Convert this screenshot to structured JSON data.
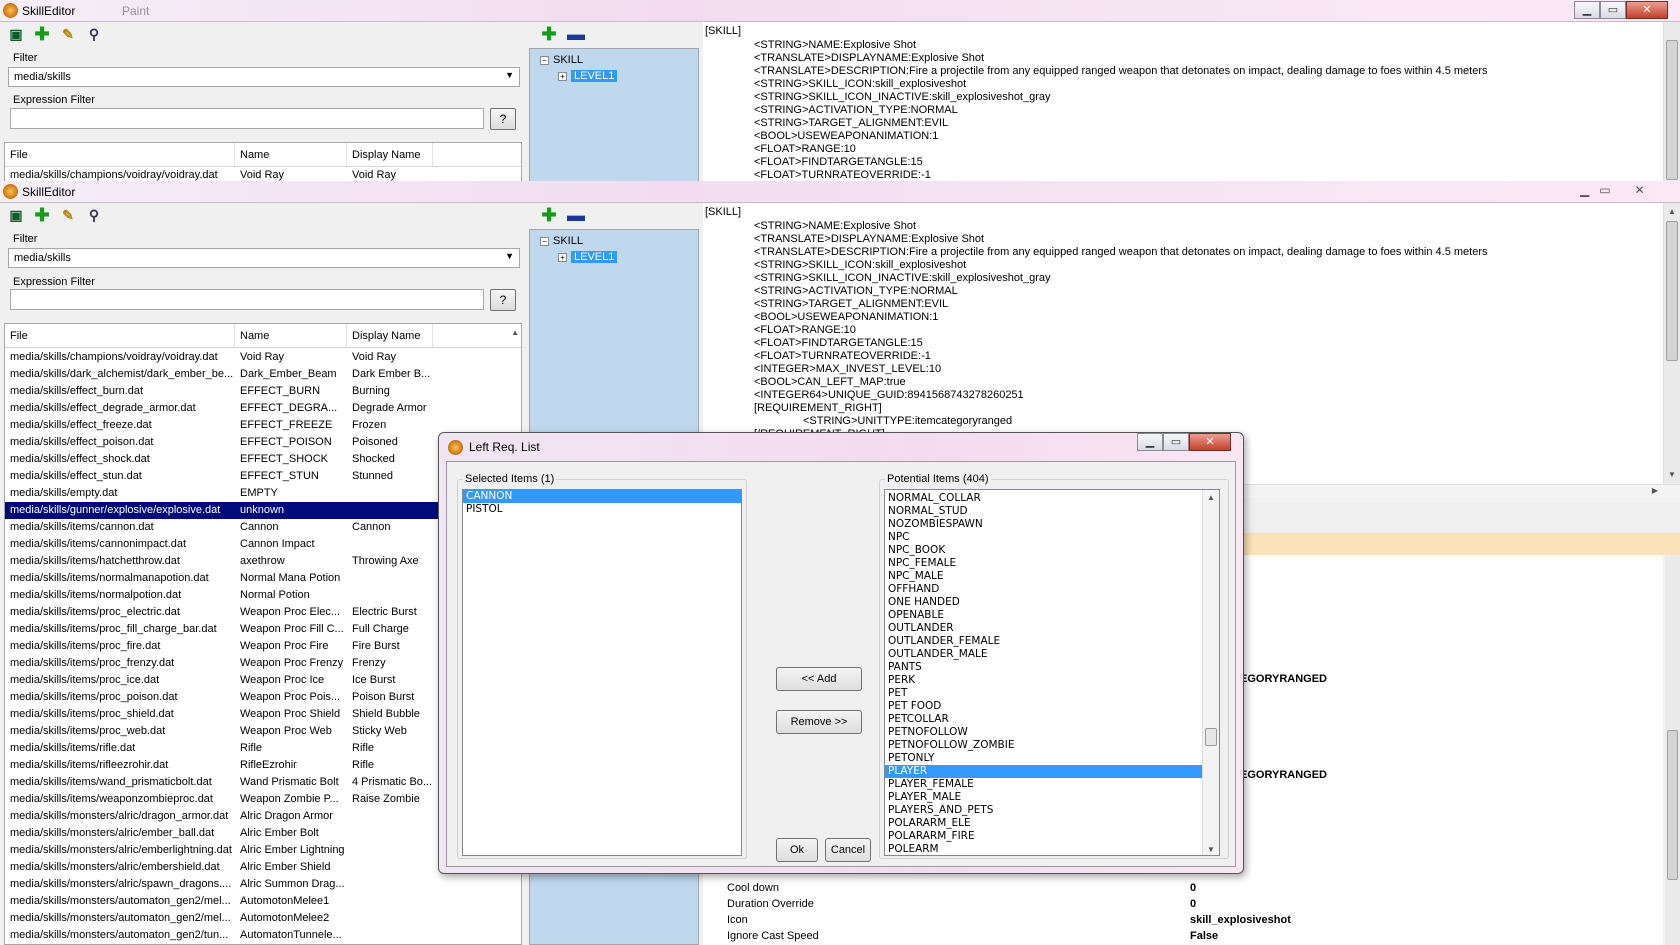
{
  "window": {
    "title": "SkillEditor",
    "back_title_fragments": [
      "Paint"
    ],
    "controls": {
      "minimize": "▁",
      "maximize": "▭",
      "close": "✕"
    }
  },
  "toolbar": {
    "icons": [
      "save-icon",
      "add-icon",
      "edit-icon",
      "search-icon"
    ],
    "tree_icons": [
      "add-icon",
      "remove-icon"
    ]
  },
  "filter": {
    "label": "Filter",
    "value": "media/skills"
  },
  "expression_filter": {
    "label": "Expression Filter",
    "value": "",
    "help_label": "?"
  },
  "file_table": {
    "columns": [
      "File",
      "Name",
      "Display Name"
    ],
    "back_rows": [
      {
        "file": "media/skills/champions/voidray/voidray.dat",
        "name": "Void Ray",
        "display": "Void Ray"
      }
    ],
    "rows": [
      {
        "file": "media/skills/champions/voidray/voidray.dat",
        "name": "Void Ray",
        "display": "Void Ray"
      },
      {
        "file": "media/skills/dark_alchemist/dark_ember_be...",
        "name": "Dark_Ember_Beam",
        "display": "Dark Ember B..."
      },
      {
        "file": "media/skills/effect_burn.dat",
        "name": "EFFECT_BURN",
        "display": "Burning"
      },
      {
        "file": "media/skills/effect_degrade_armor.dat",
        "name": "EFFECT_DEGRA...",
        "display": "Degrade Armor"
      },
      {
        "file": "media/skills/effect_freeze.dat",
        "name": "EFFECT_FREEZE",
        "display": "Frozen"
      },
      {
        "file": "media/skills/effect_poison.dat",
        "name": "EFFECT_POISON",
        "display": "Poisoned"
      },
      {
        "file": "media/skills/effect_shock.dat",
        "name": "EFFECT_SHOCK",
        "display": "Shocked"
      },
      {
        "file": "media/skills/effect_stun.dat",
        "name": "EFFECT_STUN",
        "display": "Stunned"
      },
      {
        "file": "media/skills/empty.dat",
        "name": "EMPTY",
        "display": ""
      },
      {
        "file": "media/skills/gunner/explosive/explosive.dat",
        "name": "unknown",
        "display": "",
        "selected": true
      },
      {
        "file": "media/skills/items/cannon.dat",
        "name": "Cannon",
        "display": "Cannon"
      },
      {
        "file": "media/skills/items/cannonimpact.dat",
        "name": "Cannon Impact",
        "display": ""
      },
      {
        "file": "media/skills/items/hatchetthrow.dat",
        "name": "axethrow",
        "display": "Throwing Axe"
      },
      {
        "file": "media/skills/items/normalmanapotion.dat",
        "name": "Normal Mana Potion",
        "display": ""
      },
      {
        "file": "media/skills/items/normalpotion.dat",
        "name": "Normal Potion",
        "display": ""
      },
      {
        "file": "media/skills/items/proc_electric.dat",
        "name": "Weapon Proc Elec...",
        "display": "Electric Burst"
      },
      {
        "file": "media/skills/items/proc_fill_charge_bar.dat",
        "name": "Weapon Proc Fill C...",
        "display": "Full Charge"
      },
      {
        "file": "media/skills/items/proc_fire.dat",
        "name": "Weapon Proc Fire",
        "display": "Fire Burst"
      },
      {
        "file": "media/skills/items/proc_frenzy.dat",
        "name": "Weapon Proc Frenzy",
        "display": "Frenzy"
      },
      {
        "file": "media/skills/items/proc_ice.dat",
        "name": "Weapon Proc Ice",
        "display": "Ice Burst"
      },
      {
        "file": "media/skills/items/proc_poison.dat",
        "name": "Weapon Proc Pois...",
        "display": "Poison Burst"
      },
      {
        "file": "media/skills/items/proc_shield.dat",
        "name": "Weapon Proc Shield",
        "display": "Shield Bubble"
      },
      {
        "file": "media/skills/items/proc_web.dat",
        "name": "Weapon Proc Web",
        "display": "Sticky Web"
      },
      {
        "file": "media/skills/items/rifle.dat",
        "name": "Rifle",
        "display": "Rifle"
      },
      {
        "file": "media/skills/items/rifleezrohir.dat",
        "name": "RifleEzrohir",
        "display": "Rifle"
      },
      {
        "file": "media/skills/items/wand_prismaticbolt.dat",
        "name": "Wand Prismatic Bolt",
        "display": "4 Prismatic Bo..."
      },
      {
        "file": "media/skills/items/weaponzombieproc.dat",
        "name": "Weapon Zombie P...",
        "display": "Raise Zombie"
      },
      {
        "file": "media/skills/monsters/alric/dragon_armor.dat",
        "name": "Alric Dragon Armor",
        "display": ""
      },
      {
        "file": "media/skills/monsters/alric/ember_ball.dat",
        "name": "Alric Ember Bolt",
        "display": ""
      },
      {
        "file": "media/skills/monsters/alric/emberlightning.dat",
        "name": "Alric Ember Lightning",
        "display": ""
      },
      {
        "file": "media/skills/monsters/alric/embershield.dat",
        "name": "Alric Ember Shield",
        "display": ""
      },
      {
        "file": "media/skills/monsters/alric/spawn_dragons....",
        "name": "Alric Summon Drag...",
        "display": ""
      },
      {
        "file": "media/skills/monsters/automaton_gen2/mel...",
        "name": "AutomotonMelee1",
        "display": ""
      },
      {
        "file": "media/skills/monsters/automaton_gen2/mel...",
        "name": "AutomotonMelee2",
        "display": ""
      },
      {
        "file": "media/skills/monsters/automaton_gen2/tun...",
        "name": "AutomatonTunnele...",
        "display": ""
      }
    ]
  },
  "tree": {
    "root": "SKILL",
    "child": "LEVEL1"
  },
  "skill_text": {
    "header": "[SKILL]",
    "lines": [
      "<STRING>NAME:Explosive Shot",
      "<TRANSLATE>DISPLAYNAME:Explosive Shot",
      "<TRANSLATE>DESCRIPTION:Fire a projectile from any equipped ranged weapon that detonates on impact, dealing damage to foes within 4.5 meters",
      "<STRING>SKILL_ICON:skill_explosiveshot",
      "<STRING>SKILL_ICON_INACTIVE:skill_explosiveshot_gray",
      "<STRING>ACTIVATION_TYPE:NORMAL",
      "<STRING>TARGET_ALIGNMENT:EVIL",
      "<BOOL>USEWEAPONANIMATION:1",
      "<FLOAT>RANGE:10",
      "<FLOAT>FINDTARGETANGLE:15",
      "<FLOAT>TURNRATEOVERRIDE:-1",
      "<INTEGER>MAX_INVEST_LEVEL:10",
      "<BOOL>CAN_LEFT_MAP:true",
      "<INTEGER64>UNIQUE_GUID:8941568743278260251"
    ],
    "req_open": "[REQUIREMENT_RIGHT]",
    "req_line": "<STRING>UNITTYPE:itemcategoryranged",
    "req_close": "[/REQUIREMENT_RIGHT]"
  },
  "properties": {
    "fragment_value": "EGORYRANGED",
    "rows": [
      {
        "key": "Cool down",
        "value": "0"
      },
      {
        "key": "Duration Override",
        "value": "0"
      },
      {
        "key": "Icon",
        "value": "skill_explosiveshot"
      },
      {
        "key": "Ignore Cast Speed",
        "value": "False"
      }
    ]
  },
  "dialog": {
    "title": "Left Req. List",
    "selected_label": "Selected Items (1)",
    "selected_items": [
      "CANNON",
      "PISTOL"
    ],
    "potential_label": "Potential Items (404)",
    "potential_items": [
      "NORMAL_COLLAR",
      "NORMAL_STUD",
      "NOZOMBIESPAWN",
      "NPC",
      "NPC_BOOK",
      "NPC_FEMALE",
      "NPC_MALE",
      "OFFHAND",
      "ONE HANDED",
      "OPENABLE",
      "OUTLANDER",
      "OUTLANDER_FEMALE",
      "OUTLANDER_MALE",
      "PANTS",
      "PERK",
      "PET",
      "PET FOOD",
      "PETCOLLAR",
      "PETNOFOLLOW",
      "PETNOFOLLOW_ZOMBIE",
      "PETONLY",
      "PLAYER",
      "PLAYER_FEMALE",
      "PLAYER_MALE",
      "PLAYERS_AND_PETS",
      "POLARARM_ELE",
      "POLARARM_FIRE",
      "POLEARM"
    ],
    "add_label": "<< Add",
    "remove_label": "Remove >>",
    "ok_label": "Ok",
    "cancel_label": "Cancel"
  },
  "colors": {
    "selection": "#000a7a",
    "highlight": "#3399ff",
    "tree_bg": "#c0d8ee"
  }
}
